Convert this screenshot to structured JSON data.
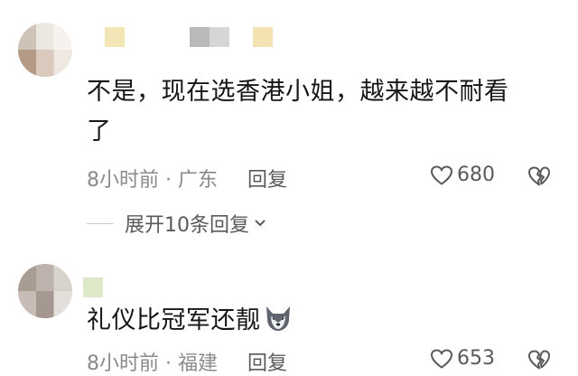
{
  "comments": [
    {
      "text_line1": "不是，现在选香港小姐，越来越不耐看",
      "text_line2": "了",
      "time": "8小时前",
      "separator": "·",
      "location": "广东",
      "reply_label": "回复",
      "likes": "680",
      "expand_label": "展开10条回复"
    },
    {
      "text_line1": "礼仪比冠军还靓",
      "emoji": "wolf-face-emoji",
      "time": "8小时前",
      "separator": "·",
      "location": "福建",
      "reply_label": "回复",
      "likes": "653"
    }
  ],
  "colors": {
    "text": "#161616",
    "meta": "#8a8a8a",
    "action": "#5a5a5a",
    "divider": "#c8c8c8"
  },
  "icons": [
    "heart-icon",
    "broken-heart-icon",
    "chevron-down-icon"
  ]
}
